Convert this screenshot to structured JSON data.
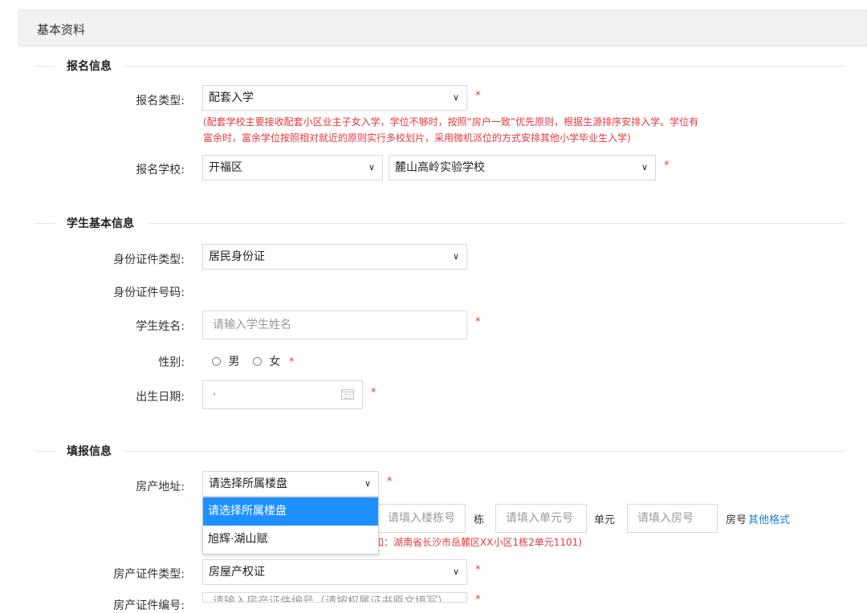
{
  "header": {
    "title": "基本资料"
  },
  "sections": {
    "signup": {
      "label": "报名信息"
    },
    "student": {
      "label": "学生基本信息"
    },
    "fill": {
      "label": "填报信息"
    }
  },
  "signup": {
    "type_label": "报名类型:",
    "type_value": "配套入学",
    "type_hint_line1": "(配套学校主要接收配套小区业主子女入学，学位不够时，按照“房户一致”优先原则，根据生源排序安排入学。学位有",
    "type_hint_line2": "富余时，富余学位按照相对就近的原则实行多校划片，采用微机派位的方式安排其他小学毕业生入学)",
    "school_label": "报名学校:",
    "district_value": "开福区",
    "school_value": "麓山高岭实验学校"
  },
  "student": {
    "id_type_label": "身份证件类型:",
    "id_type_value": "居民身份证",
    "id_number_label": "身份证件号码:",
    "name_label": "学生姓名:",
    "name_placeholder": "请输入学生姓名",
    "gender_label": "性别:",
    "gender_male": "男",
    "gender_female": "女",
    "birth_label": "出生日期:",
    "birth_value": "·"
  },
  "fill": {
    "address_label": "房产地址:",
    "address_value": "请选择所属楼盘",
    "building_placeholder": "请填入楼栋号",
    "building_unit": "栋",
    "unit_placeholder": "请填入单元号",
    "unit_unit": "单元",
    "room_placeholder": "请填入房号",
    "room_unit": "房号",
    "other_format_link": "其他格式",
    "address_hint": "如：湖南省长沙市岳麓区XX小区1栋2单元1101)",
    "dropdown_options": [
      "请选择所属楼盘",
      "旭辉·湖山赋"
    ],
    "cert_type_label": "房产证件类型:",
    "cert_type_value": "房屋产权证",
    "cert_number_label": "房产证件编号:",
    "cert_number_placeholder": "请输入房产证件编号（请按权属证书原文填写）"
  },
  "required_mark": "*",
  "chevron": "∨",
  "colors": {
    "required": "#e4393c",
    "link": "#1a7fd4",
    "selected_option": "#1e90ff"
  }
}
